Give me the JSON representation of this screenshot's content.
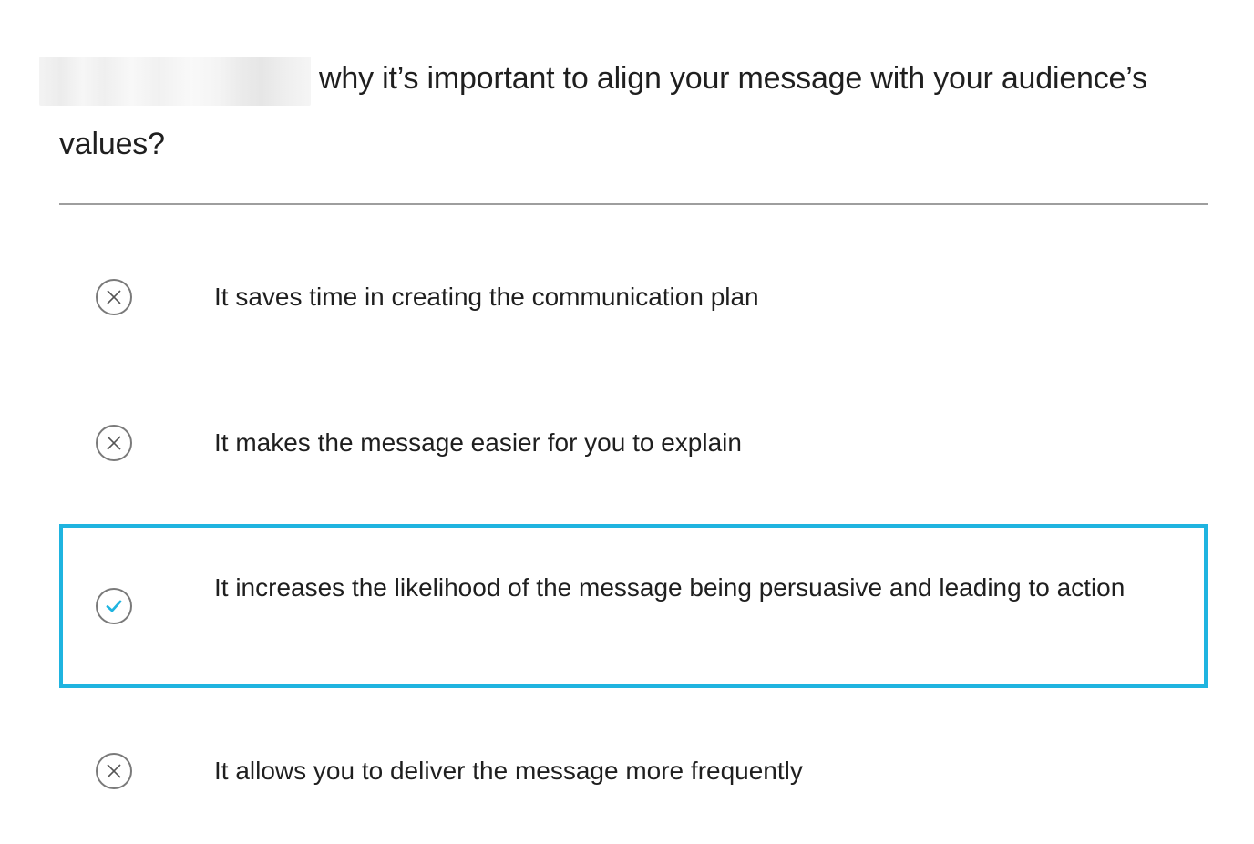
{
  "question": {
    "text": "why it’s important to align your message with your audience’s values?"
  },
  "options": [
    {
      "label": "It saves time in creating the communication plan",
      "state": "incorrect",
      "icon": "x-circle-icon"
    },
    {
      "label": "It makes the message easier for you to explain",
      "state": "incorrect",
      "icon": "x-circle-icon"
    },
    {
      "label": "It increases the likelihood of the message being persuasive and leading to action",
      "state": "correct-selected",
      "icon": "check-circle-icon"
    },
    {
      "label": "It allows you to deliver the message more frequently",
      "state": "incorrect",
      "icon": "x-circle-icon"
    }
  ],
  "colors": {
    "accent": "#1fb4e0",
    "icon_stroke": "#7a7a7a",
    "divider": "#9e9e9e"
  }
}
